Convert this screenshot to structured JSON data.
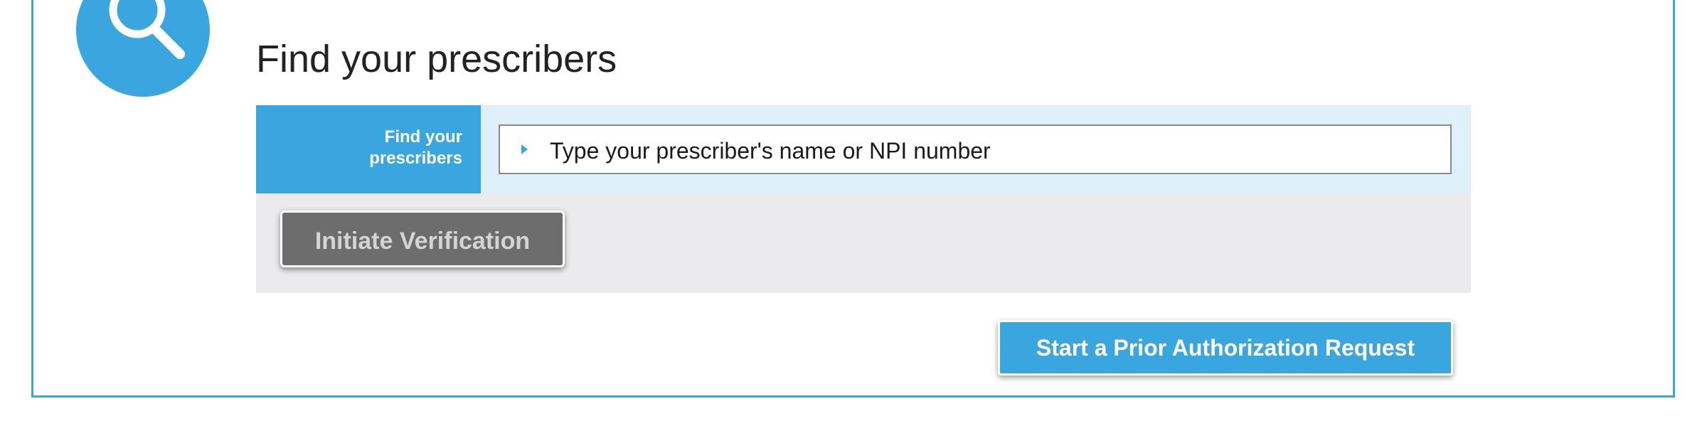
{
  "section": {
    "title": "Find your prescribers",
    "icon": "search-icon"
  },
  "find_row": {
    "label_line1": "Find your",
    "label_line2": "prescribers",
    "input_value": "Type your prescriber's name or NPI number"
  },
  "actions": {
    "initiate_verification": "Initiate Verification",
    "start_prior_authorization": "Start a Prior Authorization Request"
  },
  "colors": {
    "accent": "#3aa6e0",
    "input_row_bg": "#dff0fa",
    "verify_row_bg": "#ebebee",
    "disabled_button": "#6d6d6d"
  }
}
